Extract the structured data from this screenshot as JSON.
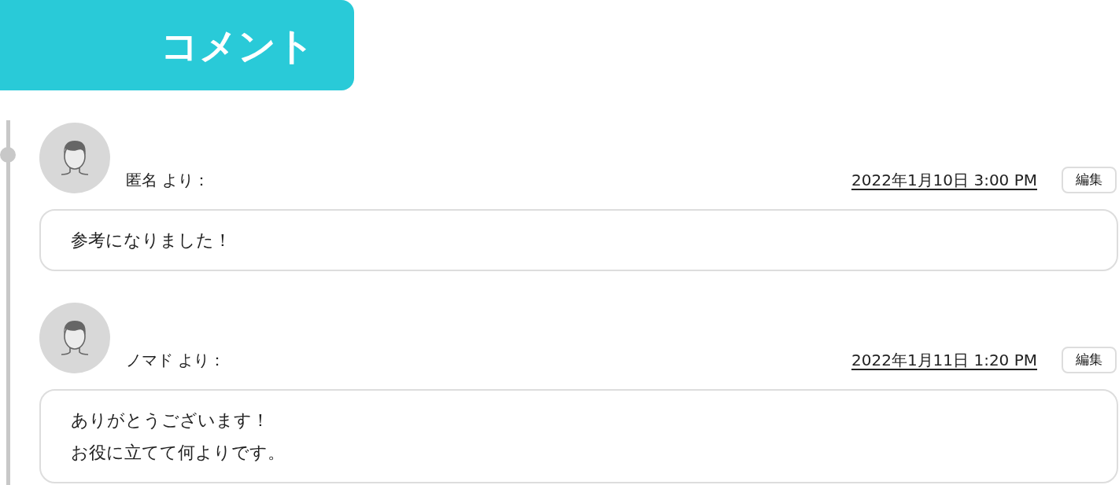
{
  "header": {
    "title": "コメント"
  },
  "comments": [
    {
      "author": "匿名 より：",
      "timestamp": "2022年1月10日 3:00 PM",
      "edit_button": "編集",
      "body_lines": [
        "参考になりました！"
      ],
      "marked": true
    },
    {
      "author": "ノマド より：",
      "timestamp": "2022年1月11日 1:20 PM",
      "edit_button": "編集",
      "body_lines": [
        "ありがとうございます！",
        "お役に立てて何よりです。"
      ],
      "marked": false
    }
  ]
}
